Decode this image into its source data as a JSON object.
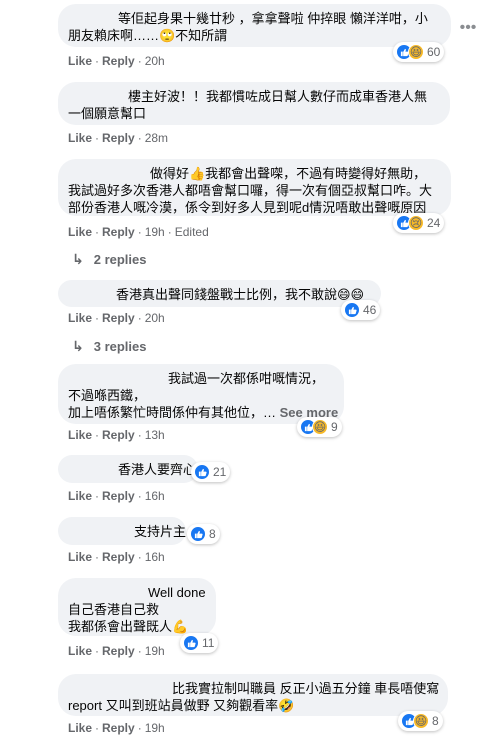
{
  "ui": {
    "like": "Like",
    "reply": "Reply",
    "see_more": "See more",
    "edited": "Edited",
    "menu_icon": "more-options-icon"
  },
  "comments": [
    {
      "lines": [
        "等佢起身果十幾廿秒 ，拿拿聲啦 仲捽眼 懶洋洋咁，小",
        "朋友賴床啊……🙄不知所謂"
      ],
      "time": "20h",
      "reactions": "60"
    },
    {
      "lines": [
        "樓主好波！！我都慣咗成日幫人數仔而成車香港人無",
        "一個願意幫口"
      ],
      "time": "28m"
    },
    {
      "lines": [
        "做得好👍我都會出聲㗎，不過有時變得好無助，",
        "我試過好多次香港人都唔會幫口囉，得一次有個亞叔幫口咋。大",
        "部份香港人嘅冷漠，係令到好多人見到呢d情況唔敢出聲嘅原因"
      ],
      "time": "19h",
      "reactions": "24",
      "replies": "2 replies"
    },
    {
      "lines": [
        "香港真出聲同錢盤戰士比例，我不敢說😄😄"
      ],
      "time": "20h",
      "reactions": "46",
      "replies": "3 replies"
    },
    {
      "lines": [
        "我試過一次都係咁嘅情況，",
        "不過喺西鐵，",
        "加上唔係繁忙時間係仲有其他位，…"
      ],
      "time": "13h",
      "reactions": "9"
    },
    {
      "lines": [
        "香港人要齊心"
      ],
      "time": "16h",
      "reactions": "21"
    },
    {
      "lines": [
        "支持片主"
      ],
      "time": "16h",
      "reactions": "8"
    },
    {
      "lines": [
        "Well done",
        "自己香港自己救",
        "我都係會出聲既人💪"
      ],
      "time": "19h",
      "reactions": "11"
    },
    {
      "lines": [
        "比我實拉制叫職員 反正小過五分鐘 車長唔使寫",
        "report 又叫到班站員做野 又夠觀看率🤣"
      ],
      "time": "19h",
      "reactions": "8"
    }
  ]
}
